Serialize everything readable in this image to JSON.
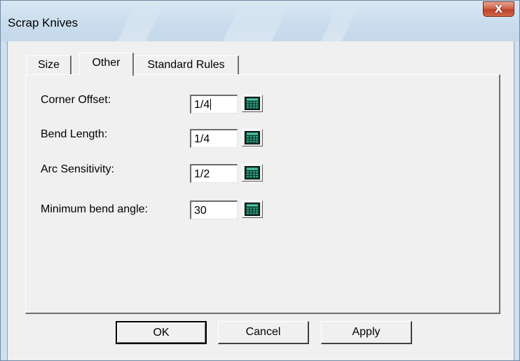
{
  "window": {
    "title": "Scrap Knives",
    "close_label": "X"
  },
  "tabs": [
    {
      "label": "Size",
      "active": false
    },
    {
      "label": "Other",
      "active": true
    },
    {
      "label": "Standard Rules",
      "active": false
    }
  ],
  "fields": [
    {
      "label": "Corner Offset:",
      "value": "1/4",
      "focused": true,
      "icon": "calculator-icon"
    },
    {
      "label": "Bend Length:",
      "value": "1/4",
      "focused": false,
      "icon": "calculator-icon"
    },
    {
      "label": "Arc Sensitivity:",
      "value": "1/2",
      "focused": false,
      "icon": "calculator-icon"
    },
    {
      "label": "Minimum bend angle:",
      "value": "30",
      "focused": false,
      "icon": "calculator-icon"
    }
  ],
  "buttons": {
    "ok": "OK",
    "cancel": "Cancel",
    "apply": "Apply"
  },
  "colors": {
    "frame": "#cfe0ef",
    "dialog_face": "#f0f0f0",
    "close_button": "#c0422a",
    "calculator_green": "#1f8a6e"
  }
}
